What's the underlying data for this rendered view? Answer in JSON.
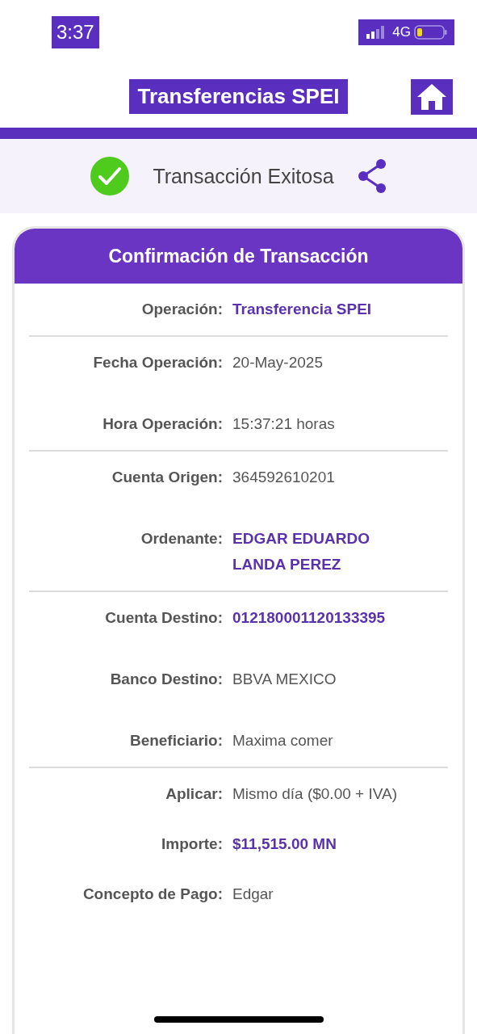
{
  "status_bar": {
    "time": "3:37",
    "network": "4G"
  },
  "header": {
    "title": "Transferencias SPEI"
  },
  "result": {
    "message": "Transacción Exitosa"
  },
  "card": {
    "title": "Confirmación de Transacción",
    "groups": [
      {
        "rows": [
          {
            "label": "Operación:",
            "value": "Transferencia SPEI",
            "kind": "highlight"
          }
        ]
      },
      {
        "rows": [
          {
            "label": "Fecha Operación:",
            "value": "20-May-2025",
            "kind": "plain"
          },
          {
            "label": "Hora Operación:",
            "value": "15:37:21 horas",
            "kind": "plain"
          }
        ]
      },
      {
        "rows": [
          {
            "label": "Cuenta Origen:",
            "value": "364592610201",
            "kind": "plain"
          },
          {
            "label": "Ordenante:",
            "value": "EDGAR EDUARDO LANDA PEREZ",
            "kind": "highlight"
          }
        ]
      },
      {
        "rows": [
          {
            "label": "Cuenta Destino:",
            "value": "012180001120133395",
            "kind": "highlight"
          },
          {
            "label": "Banco Destino:",
            "value": "BBVA MEXICO",
            "kind": "plain"
          },
          {
            "label": "Beneficiario:",
            "value": "Maxima comer",
            "kind": "plain"
          }
        ]
      },
      {
        "rows": [
          {
            "label": "Aplicar:",
            "value": "Mismo día ($0.00 + IVA)",
            "kind": "plain"
          },
          {
            "label": "Importe:",
            "value": "$11,515.00 MN",
            "kind": "highlight"
          },
          {
            "label": "Concepto de Pago:",
            "value": "Edgar",
            "kind": "plain"
          }
        ]
      }
    ]
  }
}
